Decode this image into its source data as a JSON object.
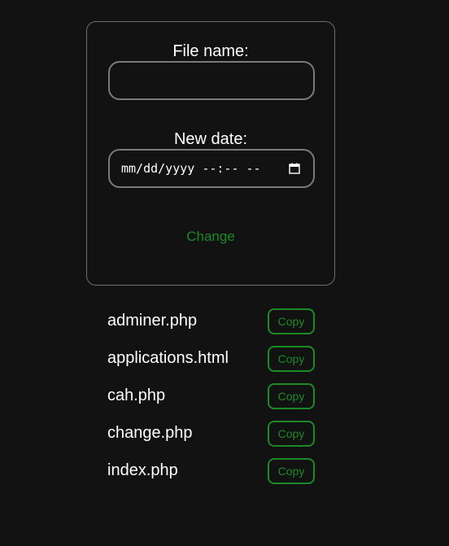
{
  "form": {
    "file_name_label": "File name:",
    "file_name_value": "",
    "new_date_label": "New date:",
    "new_date_display": "mm/dd/yyyy --:-- --",
    "change_label": "Change"
  },
  "files": [
    {
      "name": "adminer.php",
      "copy_label": "Copy"
    },
    {
      "name": "applications.html",
      "copy_label": "Copy"
    },
    {
      "name": "cah.php",
      "copy_label": "Copy"
    },
    {
      "name": "change.php",
      "copy_label": "Copy"
    },
    {
      "name": "index.php",
      "copy_label": "Copy"
    }
  ],
  "colors": {
    "background": "#121212",
    "accent": "#1a8a27",
    "text": "#ffffff",
    "border": "#7a7a7a"
  }
}
